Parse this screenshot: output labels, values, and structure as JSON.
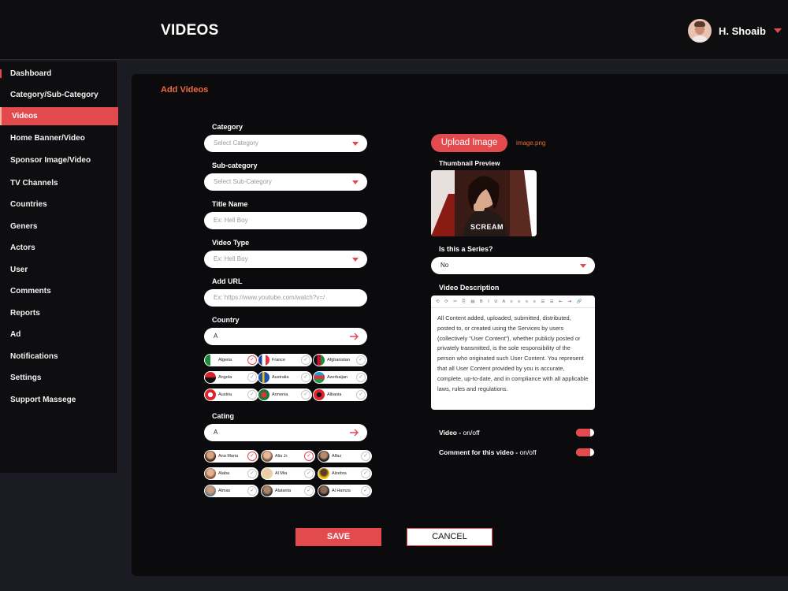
{
  "header": {
    "title": "VIDEOS",
    "user_name": "H. Shoaib"
  },
  "sidebar": {
    "items": [
      {
        "label": "Dashboard"
      },
      {
        "label": "Category/Sub-Category"
      },
      {
        "label": "Videos",
        "active": true
      },
      {
        "label": "Home Banner/Video"
      },
      {
        "label": "Sponsor Image/Video"
      },
      {
        "label": "TV Channels"
      },
      {
        "label": "Countries"
      },
      {
        "label": "Geners"
      },
      {
        "label": "Actors"
      },
      {
        "label": "User"
      },
      {
        "label": "Comments"
      },
      {
        "label": "Reports"
      },
      {
        "label": "Ad"
      },
      {
        "label": "Notifications"
      },
      {
        "label": "Settings"
      },
      {
        "label": "Support Massege"
      }
    ]
  },
  "form": {
    "section_title": "Add Videos",
    "category": {
      "label": "Category",
      "placeholder": "Select Category"
    },
    "subcategory": {
      "label": "Sub-category",
      "placeholder": "Select Sub-Category"
    },
    "title_name": {
      "label": "Title Name",
      "placeholder": "Ex: Hell Boy"
    },
    "video_type": {
      "label": "Video Type",
      "placeholder": "Ex: Hell Boy"
    },
    "url": {
      "label": "Add URL",
      "placeholder": "Ex: https://www.youtube.com/watch?v=/"
    },
    "country": {
      "label": "Country",
      "value": "A"
    },
    "countries": [
      {
        "name": "Algeria",
        "checked": true
      },
      {
        "name": "France",
        "checked": false
      },
      {
        "name": "Afghanistan",
        "checked": false
      },
      {
        "name": "Angola",
        "checked": false
      },
      {
        "name": "Australia",
        "checked": false
      },
      {
        "name": "Azerbaijan",
        "checked": false
      },
      {
        "name": "Austria",
        "checked": false
      },
      {
        "name": "Armenia",
        "checked": false
      },
      {
        "name": "Albania",
        "checked": false
      }
    ],
    "cating": {
      "label": "Cating",
      "value": "A"
    },
    "cast": [
      {
        "name": "Ana Maria",
        "checked": true
      },
      {
        "name": "Alia Jr.",
        "checked": true
      },
      {
        "name": "Alfaz",
        "checked": false
      },
      {
        "name": "Alaba",
        "checked": false
      },
      {
        "name": "Al Mia",
        "checked": false
      },
      {
        "name": "Alzebra",
        "checked": false
      },
      {
        "name": "Almas",
        "checked": false
      },
      {
        "name": "Alatanta",
        "checked": false
      },
      {
        "name": "Al Hamza",
        "checked": false
      }
    ],
    "upload_label": "Upload Image",
    "file_name": "image.png",
    "thumbnail_label": "Thumbnail Preview",
    "thumbnail_caption": "SCREAM",
    "series": {
      "label": "Is this a Series?",
      "value": "No"
    },
    "description": {
      "label": "Video Description",
      "toolbar": "⟲ ⟳ ✂ ⎘ ▤ B I U A ≡ ≡ ≡ ≡ ☰ ☰ ⇤ ⇥ 🔗",
      "text": "All Content added, uploaded, submitted, distributed, posted to, or created using the Services by users (collectively \"User Content\"), whether publicly posted or privately transmitted, is the sole responsibility of the person who originated such User Content. You represent that all User Content provided by you is accurate, complete, up-to-date, and in compliance with all applicable laws, rules and regulations."
    },
    "toggles": [
      {
        "label": "Video - ",
        "sub": "on/off"
      },
      {
        "label": "Comment for this video - ",
        "sub": "on/off"
      }
    ],
    "save_label": "SAVE",
    "cancel_label": "CANCEL"
  },
  "colors": {
    "accent": "#e24a4e",
    "accent_text": "#ef6a3a",
    "panel": "#0b0b0d",
    "background": "#1b1b24"
  }
}
